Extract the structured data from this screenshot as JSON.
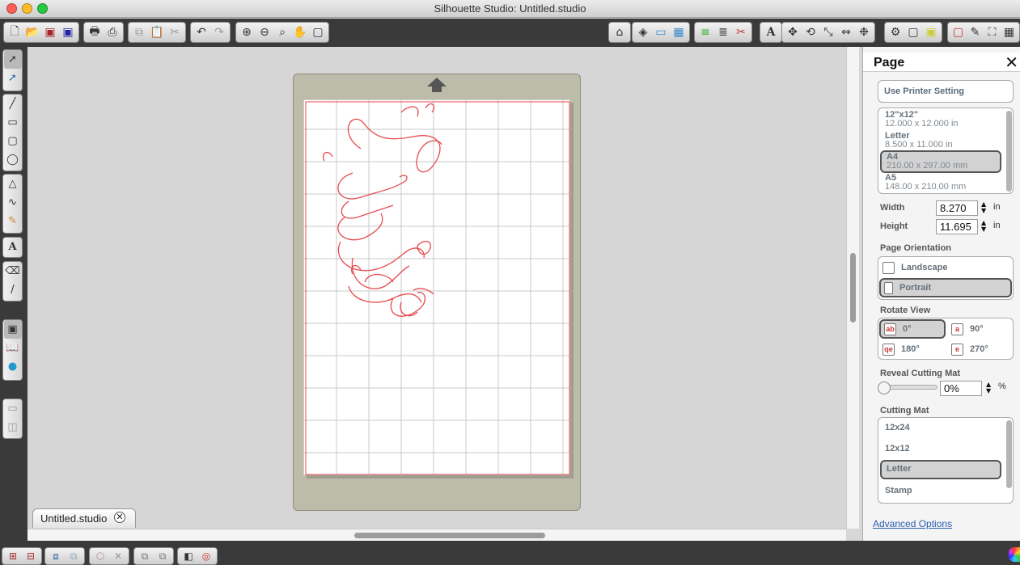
{
  "window": {
    "title": "Silhouette Studio: Untitled.studio"
  },
  "document_tab": {
    "label": "Untitled.studio",
    "close": "✕"
  },
  "panel": {
    "title": "Page",
    "close": "✕",
    "printer_setting": "Use Printer Setting",
    "page_sizes": [
      {
        "name": "12\"x12\"",
        "dims": "12.000 x 12.000 in",
        "selected": false
      },
      {
        "name": "Letter",
        "dims": "8.500 x 11.000 in",
        "selected": false
      },
      {
        "name": "A4",
        "dims": "210.00 x 297.00 mm",
        "selected": true
      },
      {
        "name": "A5",
        "dims": "148.00 x 210.00 mm",
        "selected": false
      }
    ],
    "width_label": "Width",
    "width_value": "8.270",
    "width_unit": "in",
    "height_label": "Height",
    "height_value": "11.695",
    "height_unit": "in",
    "orientation_label": "Page Orientation",
    "orientation_landscape": "Landscape",
    "orientation_portrait": "Portrait",
    "orientation_selected": "Portrait",
    "rotate_label": "Rotate View",
    "rotate_0": "0°",
    "rotate_90": "90°",
    "rotate_180": "180°",
    "rotate_270": "270°",
    "rotate_selected": "0°",
    "reveal_label": "Reveal Cutting Mat",
    "reveal_value": "0%",
    "reveal_unit": "%",
    "mat_label": "Cutting Mat",
    "mats": [
      "12x24",
      "12x12",
      "Letter",
      "Stamp"
    ],
    "mat_selected": "Letter",
    "advanced_link": "Advanced Options"
  },
  "colors": {
    "accent_link": "#2a5db0",
    "design_red": "#e8494d",
    "toolbar_dark": "#3a3a3a",
    "mat": "#bdbcaa"
  }
}
